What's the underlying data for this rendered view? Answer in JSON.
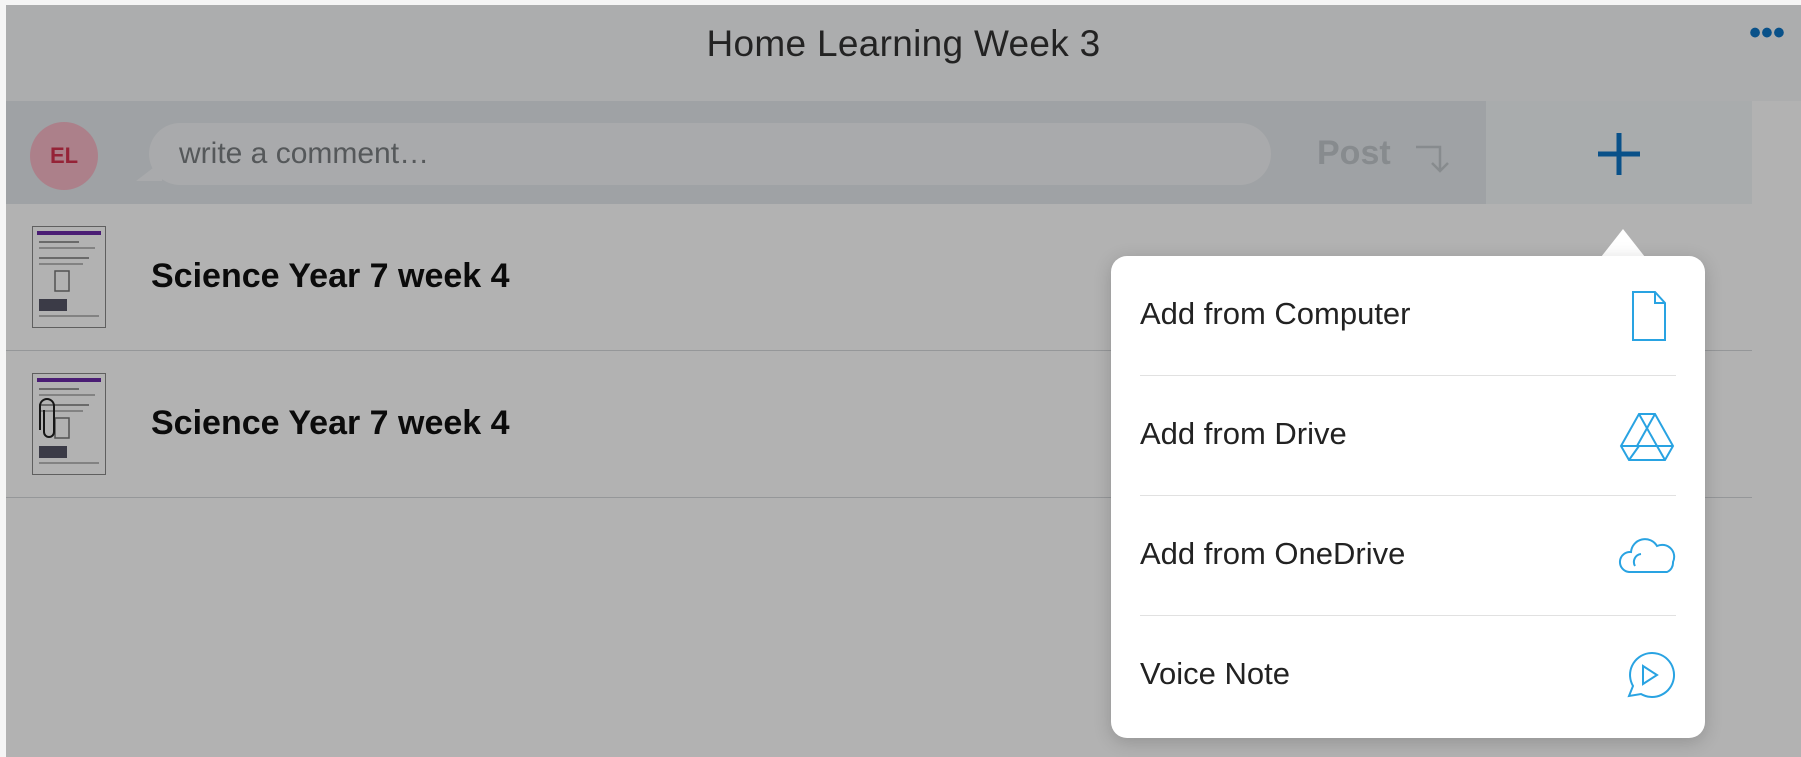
{
  "header": {
    "title": "Home Learning Week 3",
    "more_label": "•••"
  },
  "comment": {
    "avatar_initials": "EL",
    "placeholder": "write a comment…",
    "post_label": "Post"
  },
  "attachments": [
    {
      "title": "Science Year 7 week 4"
    },
    {
      "title": "Science Year 7 week 4"
    }
  ],
  "add_menu": {
    "items": [
      {
        "label": "Add from Computer",
        "icon": "file-icon"
      },
      {
        "label": "Add from Drive",
        "icon": "google-drive-icon"
      },
      {
        "label": "Add from OneDrive",
        "icon": "onedrive-cloud-icon"
      },
      {
        "label": "Voice Note",
        "icon": "voice-note-icon"
      }
    ]
  },
  "colors": {
    "accent": "#0e74c4",
    "menu_icon": "#29a3e2",
    "avatar_bg": "#f6b8c6",
    "avatar_text": "#d6334f"
  }
}
